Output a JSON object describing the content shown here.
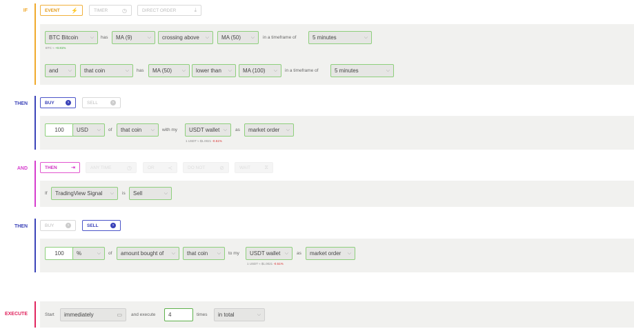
{
  "if": {
    "label": "IF",
    "tabs": {
      "event": "EVENT",
      "timer": "TIMER",
      "direct_order": "DIRECT ORDER"
    },
    "row1": {
      "coin": "BTC Bitcoin",
      "has": "has",
      "indicator": "MA (9)",
      "comparison": "crossing above",
      "target": "MA (50)",
      "timeframe_text": "in a timeframe of",
      "timeframe": "5 minutes",
      "price_note_label": "BTC ≈",
      "price_note_change": "+0.81%"
    },
    "row2": {
      "conjunction": "and",
      "coin": "that coin",
      "has": "has",
      "indicator": "MA (50)",
      "comparison": "lower than",
      "target": "MA (100)",
      "timeframe_text": "in a timeframe of",
      "timeframe": "5 minutes"
    }
  },
  "then1": {
    "label": "THEN",
    "tabs": {
      "buy": "BUY",
      "sell": "SELL"
    },
    "amount": "100",
    "unit": "USD",
    "of": "of",
    "coin": "that coin",
    "with_my": "with my",
    "wallet": "USDT wallet",
    "as": "as",
    "order_type": "market order",
    "wallet_note_label": "1 USDT ≈ $1.0021",
    "wallet_note_change": "-0.51%"
  },
  "and_block": {
    "label": "AND",
    "tabs": {
      "then": "THEN",
      "any_time": "ANY TIME",
      "or": "OR",
      "do_not": "DO NOT",
      "wait": "WAIT"
    },
    "if_text": "If",
    "signal": "TradingView Signal",
    "is_text": "is",
    "value": "Sell"
  },
  "then2": {
    "label": "THEN",
    "tabs": {
      "buy": "BUY",
      "sell": "SELL"
    },
    "amount": "100",
    "unit": "%",
    "of": "of",
    "basis": "amount bought of",
    "coin": "that coin",
    "to_my": "to my",
    "wallet": "USDT wallet",
    "as": "as",
    "order_type": "market order",
    "wallet_note_label": "1 USDT ≈ $1.0021",
    "wallet_note_change": "-0.51%"
  },
  "execute": {
    "label": "EXECUTE",
    "start": "Start",
    "start_value": "immediately",
    "and_execute": "and execute",
    "times_value": "4",
    "times": "times",
    "scope": "in total"
  },
  "colors": {
    "if": "#f0a92a",
    "then": "#3a42b8",
    "and": "#d63ccd",
    "execute": "#e0245e"
  }
}
